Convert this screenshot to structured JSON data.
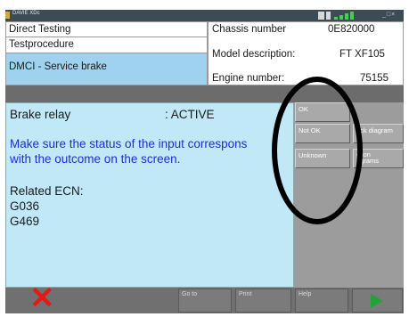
{
  "window": {
    "title": "DAVIE XDc"
  },
  "header": {
    "rows": [
      "Direct Testing",
      "Testprocedure",
      "DMCI - Service brake"
    ],
    "info": [
      {
        "label": "Chassis number",
        "value": "0E820000"
      },
      {
        "label": "Model description:",
        "value": "FT XF105"
      },
      {
        "label": "Engine number:",
        "value": "75155"
      }
    ]
  },
  "main": {
    "status_label": "Brake relay",
    "status_value": ": ACTIVE",
    "instruction_line1": "Make sure the status of the input correspons",
    "instruction_line2": "with the outcome on the screen.",
    "related_heading": "Related ECN:",
    "ecn_codes": [
      "G036",
      "G469"
    ]
  },
  "side_buttons": {
    "ok": "OK",
    "not_ok": "Not OK",
    "unknown": "Unknown",
    "block_diagram": "ock diagram",
    "function_diagrams_1": "ction",
    "function_diagrams_2": "agrams"
  },
  "bottom_buttons": {
    "goto": "Go to",
    "print": "Print",
    "help": "Help"
  },
  "colors": {
    "main_bg": "#c0e8f7",
    "instruction_text": "#1c2fd6",
    "selected_row": "#9fd2ee",
    "annotation": "#000000",
    "annotation_x": "#e01b16",
    "next_arrow": "#22a33a"
  },
  "icons": {
    "app": "app-icon",
    "network": "signal-bars-icon",
    "next": "play-arrow-icon",
    "annotation_mark": "red-x-icon"
  }
}
